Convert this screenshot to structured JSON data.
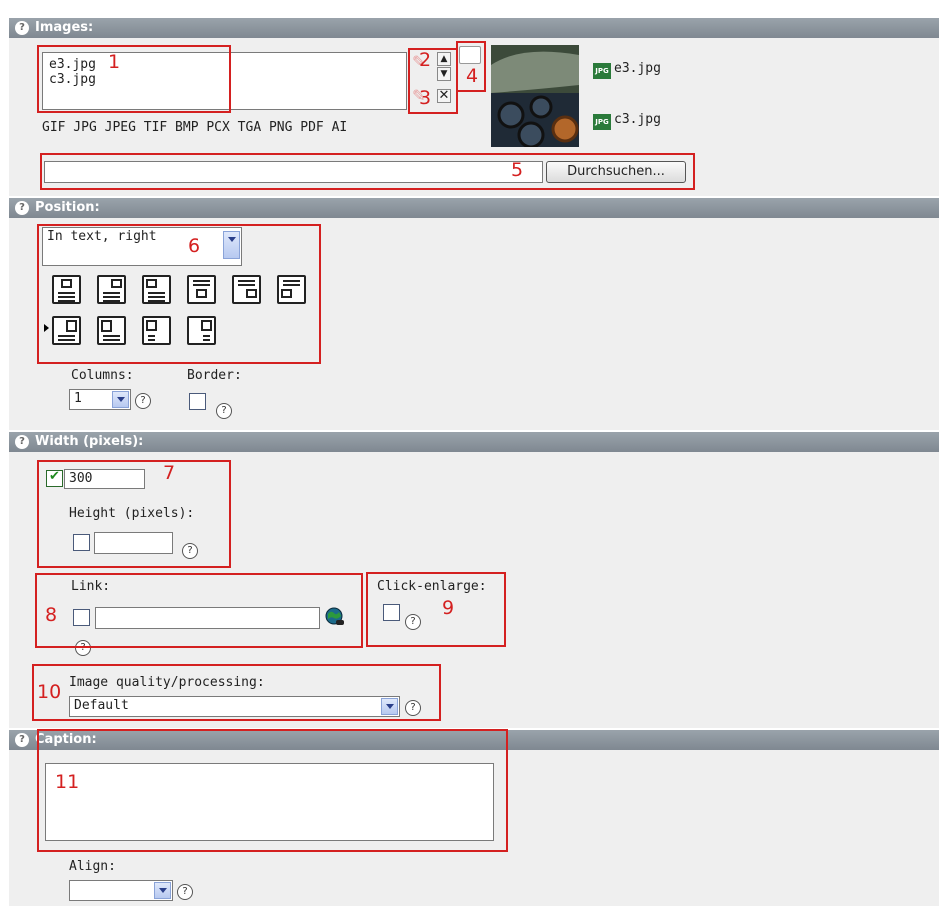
{
  "sections": {
    "images": "Images:",
    "position": "Position:",
    "width": "Width (pixels):",
    "caption": "Caption:"
  },
  "images": {
    "list": [
      "e3.jpg",
      "c3.jpg"
    ],
    "allowed_types": "GIF JPG JPEG TIF BMP PCX TGA PNG PDF AI",
    "thumb_labels": [
      "e3.jpg",
      "c3.jpg"
    ],
    "browse_button": "Durchsuchen...",
    "file_input_value": ""
  },
  "position": {
    "selected": "In text, right",
    "columns_label": "Columns:",
    "columns_value": "1",
    "border_label": "Border:"
  },
  "size": {
    "width_value": "300",
    "height_label": "Height (pixels):",
    "height_value": "",
    "link_label": "Link:",
    "link_value": "",
    "click_enlarge_label": "Click-enlarge:",
    "quality_label": "Image quality/processing:",
    "quality_value": "Default"
  },
  "caption": {
    "value": "",
    "align_label": "Align:",
    "align_value": ""
  },
  "annotations": [
    "1",
    "2",
    "3",
    "4",
    "5",
    "6",
    "7",
    "8",
    "9",
    "10",
    "11"
  ],
  "icons": {
    "help": "?",
    "jpg_badge": "JPG"
  },
  "colors": {
    "header": "#8c959d",
    "panel": "#efefef",
    "annotation": "#d42020"
  }
}
